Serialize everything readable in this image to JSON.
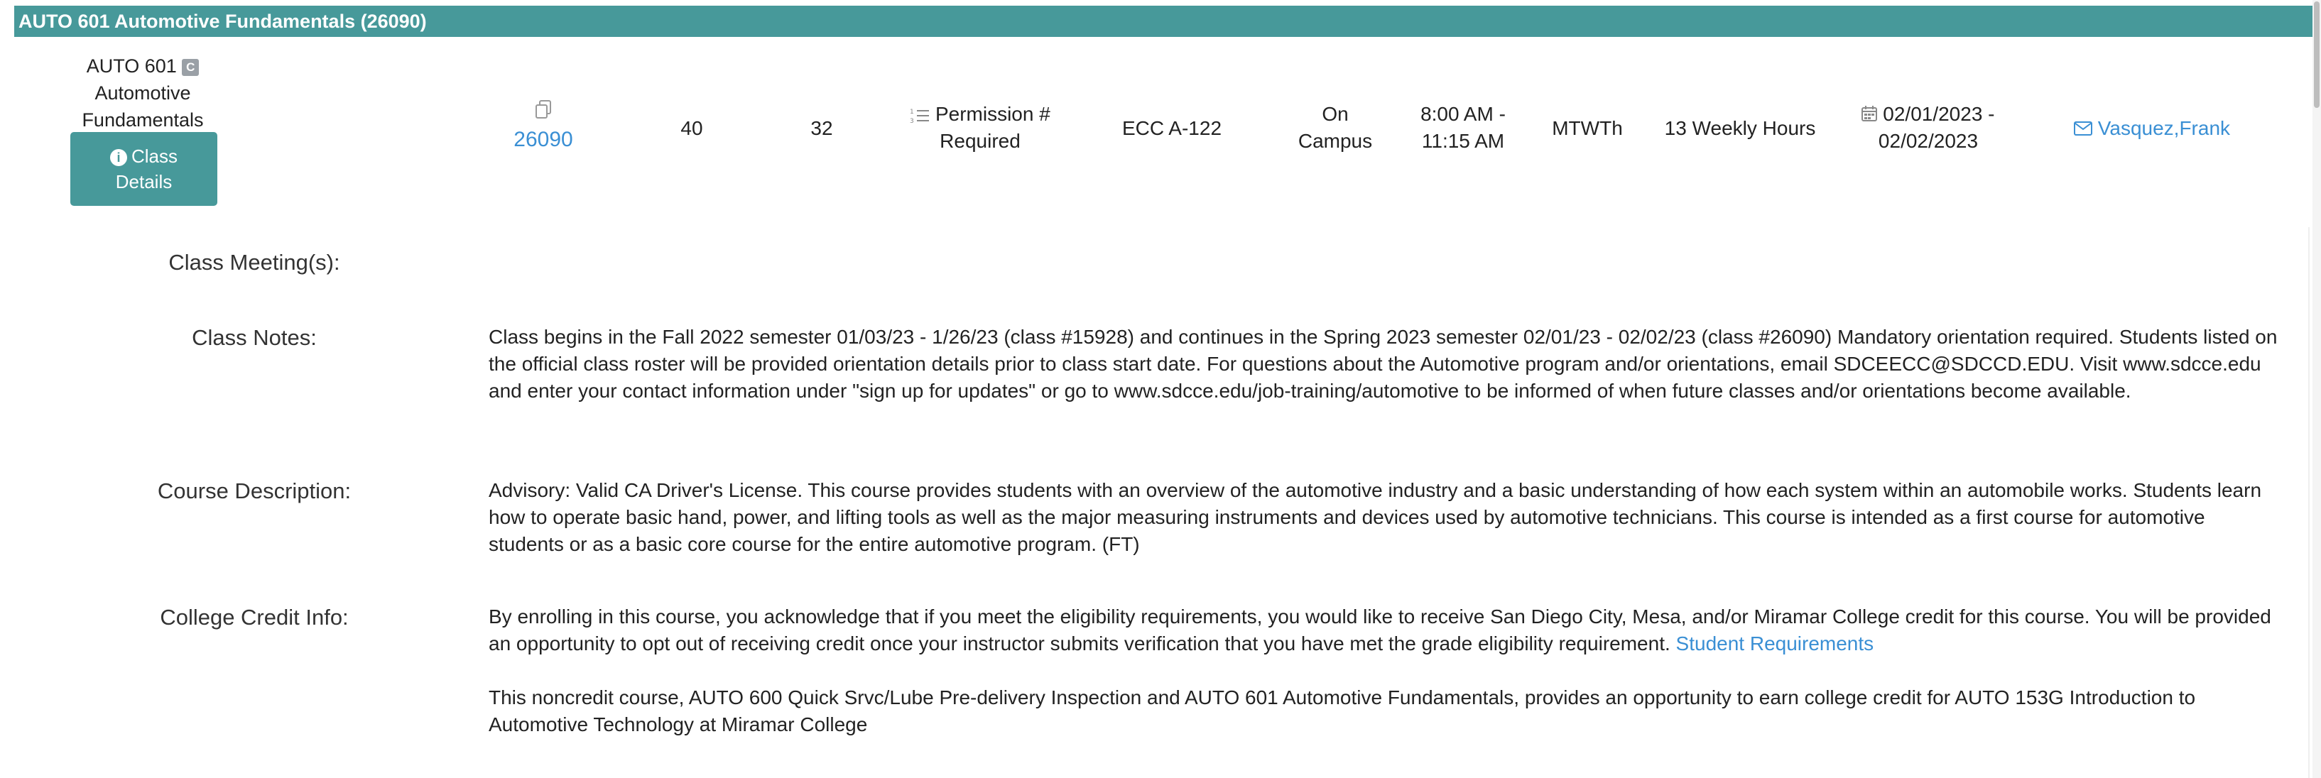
{
  "header": {
    "title": "AUTO 601 Automotive Fundamentals (26090)"
  },
  "course": {
    "code": "AUTO 601",
    "badge": "C",
    "name_line1": "Automotive",
    "name_line2": "Fundamentals",
    "details_button": {
      "line1": "Class",
      "line2": "Details"
    }
  },
  "row": {
    "class_number": "26090",
    "seats": "40",
    "available": "32",
    "permission_line1": "Permission #",
    "permission_line2": "Required",
    "room": "ECC A-122",
    "location_line1": "On",
    "location_line2": "Campus",
    "time_line1": "8:00 AM -",
    "time_line2": "11:15 AM",
    "days": "MTWTh",
    "hours": "13 Weekly Hours",
    "dates_line1": "02/01/2023 -",
    "dates_line2": "02/02/2023",
    "instructor": "Vasquez,Frank"
  },
  "icons": {
    "copy": "copy-icon",
    "list": "list-icon",
    "calendar": "calendar-icon",
    "mail": "mail-icon",
    "info": "info-icon"
  },
  "labels": {
    "meetings": "Class Meeting(s):",
    "notes": "Class Notes:",
    "description": "Course Description:",
    "credit": "College Credit Info:"
  },
  "notes_text": "Class begins in the Fall 2022 semester 01/03/23 - 1/26/23 (class #15928) and continues in the Spring 2023 semester 02/01/23 - 02/02/23 (class #26090) Mandatory orientation required. Students listed on the official class roster will be provided orientation details prior to class start date. For questions about the Automotive program and/or orientations, email SDCEECC@SDCCD.EDU. Visit www.sdcce.edu and enter your contact information under \"sign up for updates\" or go to www.sdcce.edu/job-training/automotive to be informed of when future classes and/or orientations become available.",
  "description_text": "Advisory: Valid CA Driver's License. This course provides students with an overview of the automotive industry and a basic understanding of how each system within an automobile works. Students learn how to operate basic hand, power, and lifting tools as well as the major measuring instruments and devices used by automotive technicians. This course is intended as a first course for automotive students or as a basic core course for the entire automotive program. (FT)",
  "credit": {
    "text1": "By enrolling in this course, you acknowledge that if you meet the eligibility requirements, you would like to receive San Diego City, Mesa, and/or Miramar College credit for this course. You will be provided an opportunity to opt out of receiving credit once your instructor submits verification that you have met the grade eligibility requirement.",
    "link": "Student Requirements",
    "text2": "This noncredit course, AUTO 600 Quick Srvc/Lube Pre-delivery Inspection and AUTO 601 Automotive Fundamentals, provides an opportunity to earn college credit for AUTO 153G Introduction to Automotive Technology at Miramar College"
  },
  "colors": {
    "accent": "#47999a",
    "link": "#3a8fd4"
  }
}
